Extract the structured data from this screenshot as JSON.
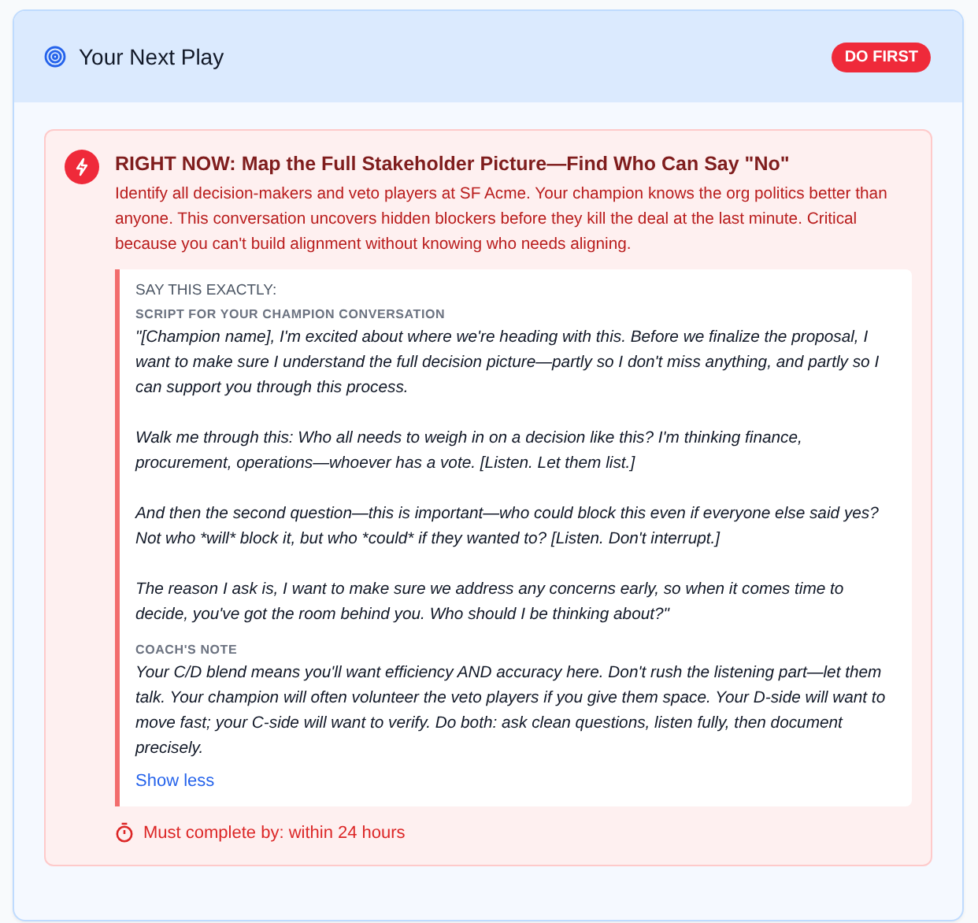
{
  "header": {
    "title": "Your Next Play",
    "badge": "DO FIRST"
  },
  "play": {
    "title": "RIGHT NOW: Map the Full Stakeholder Picture—Find Who Can Say \"No\"",
    "description": "Identify all decision-makers and veto players at SF Acme. Your champion knows the org politics better than anyone. This conversation uncovers hidden blockers before they kill the deal at the last minute. Critical because you can't build alignment without knowing who needs aligning.",
    "script": {
      "heading": "SAY THIS EXACTLY:",
      "subheading": "SCRIPT FOR YOUR CHAMPION CONVERSATION",
      "paragraphs": [
        "\"[Champion name], I'm excited about where we're heading with this. Before we finalize the proposal, I want to make sure I understand the full decision picture—partly so I don't miss anything, and partly so I can support you through this process.",
        "Walk me through this: Who all needs to weigh in on a decision like this? I'm thinking finance, procurement, operations—whoever has a vote. [Listen. Let them list.]",
        "And then the second question—this is important—who could block this even if everyone else said yes? Not who *will* block it, but who *could* if they wanted to? [Listen. Don't interrupt.]",
        "The reason I ask is, I want to make sure we address any concerns early, so when it comes time to decide, you've got the room behind you. Who should I be thinking about?\""
      ],
      "note_heading": "COACH'S NOTE",
      "note": "Your C/D blend means you'll want efficiency AND accuracy here. Don't rush the listening part—let them talk. Your champion will often volunteer the veto players if you give them space. Your D-side will want to move fast; your C-side will want to verify. Do both: ask clean questions, listen fully, then document precisely.",
      "toggle": "Show less"
    },
    "deadline": "Must complete by: within 24 hours"
  }
}
